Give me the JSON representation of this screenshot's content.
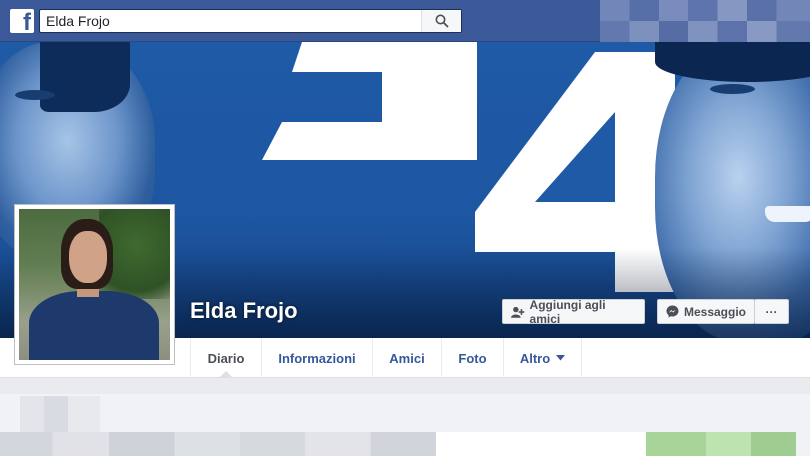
{
  "header": {
    "logo_letter": "f",
    "search": {
      "value": "Elda Frojo",
      "icon": "search-icon"
    }
  },
  "profile": {
    "name": "Elda Frojo"
  },
  "actions": {
    "add_friend": "Aggiungi agli amici",
    "message": "Messaggio",
    "more": "···"
  },
  "tabs": [
    {
      "label": "Diario",
      "active": true
    },
    {
      "label": "Informazioni",
      "active": false
    },
    {
      "label": "Amici",
      "active": false
    },
    {
      "label": "Foto",
      "active": false
    },
    {
      "label": "Altro",
      "active": false
    }
  ],
  "colors": {
    "brand": "#3b5998",
    "link": "#365899",
    "cover_blue": "#1f5aa6"
  }
}
